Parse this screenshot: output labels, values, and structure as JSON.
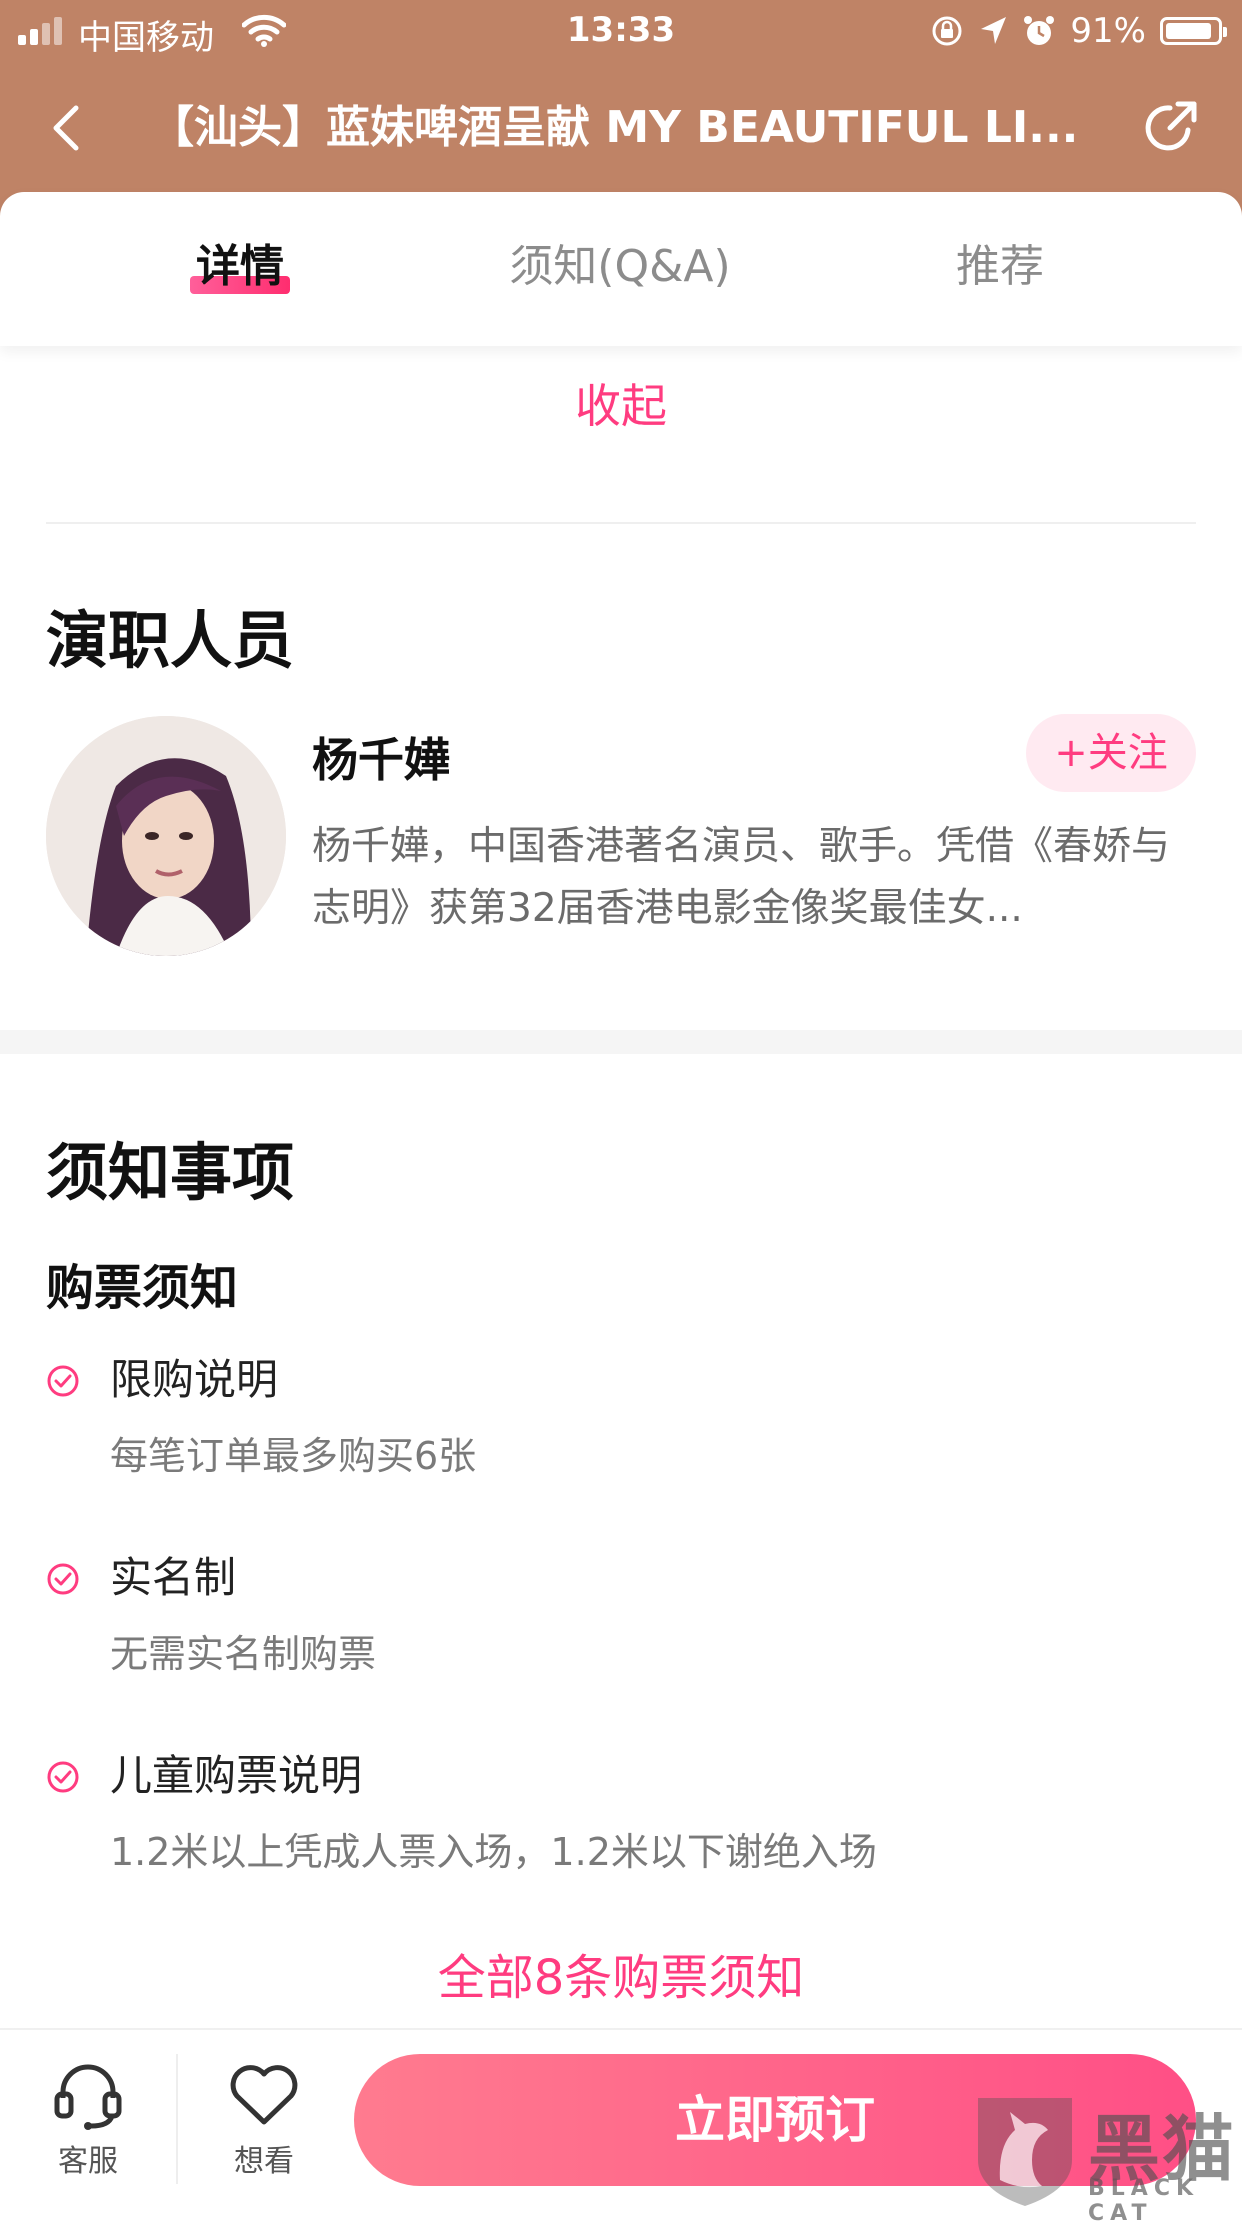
{
  "status_bar": {
    "carrier": "中国移动",
    "time": "13:33",
    "battery": "91%",
    "battery_level": 0.91
  },
  "nav": {
    "title": "【汕头】蓝妹啤酒呈献 MY BEAUTIFUL LI..."
  },
  "tabs": [
    {
      "label": "详情",
      "active": true
    },
    {
      "label": "须知(Q&A)",
      "active": false
    },
    {
      "label": "推荐",
      "active": false
    }
  ],
  "details": {
    "collapse_label": "收起"
  },
  "cast": {
    "title": "演职人员",
    "name": "杨千嬅",
    "follow_label": "+关注",
    "description": "杨千嬅，中国香港著名演员、歌手。凭借《春娇与志明》获第32届香港电影金像奖最佳女..."
  },
  "notice": {
    "title": "须知事项",
    "subtitle": "购票须知",
    "items": [
      {
        "label": "限购说明",
        "desc": "每笔订单最多购买6张"
      },
      {
        "label": "实名制",
        "desc": "无需实名制购票"
      },
      {
        "label": "儿童购票说明",
        "desc": "1.2米以上凭成人票入场，1.2米以下谢绝入场"
      }
    ],
    "all_link": "全部8条购票须知"
  },
  "bottom_bar": {
    "service_label": "客服",
    "want_label": "想看",
    "book_label": "立即预订"
  },
  "watermark": {
    "text": "黑猫",
    "sub": "BLACK CAT"
  },
  "colors": {
    "header": "#bf8366",
    "accent": "#ff3c80"
  }
}
